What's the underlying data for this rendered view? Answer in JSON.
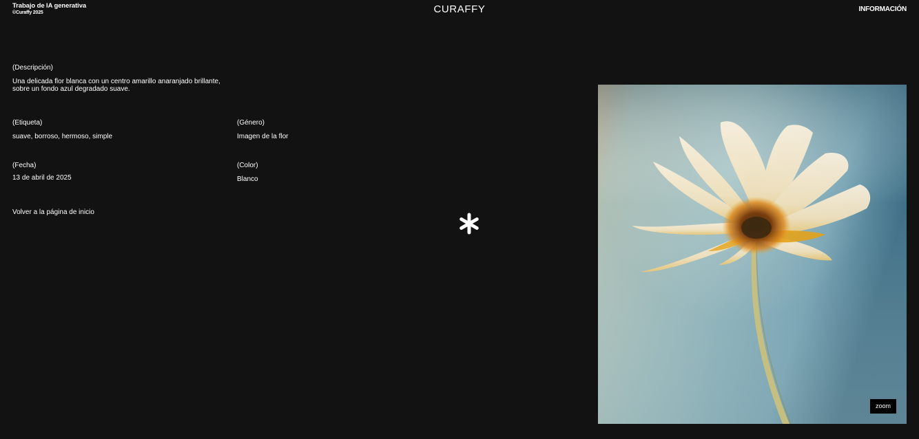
{
  "header": {
    "tagline": "Trabajo de IA generativa",
    "copyright": "©Curaffy 2025",
    "logo": "CURAFFY",
    "nav_info": "INFORMACIÓN"
  },
  "details": {
    "description_label": "(Descripción)",
    "description_text": "Una delicada flor blanca con un centro amarillo anaranjado brillante, sobre un fondo azul degradado suave.",
    "tag_label": "(Etiqueta)",
    "tag_value": "suave, borroso, hermoso, simple",
    "genre_label": "(Género)",
    "genre_value": "Imagen de la flor",
    "date_label": "(Fecha)",
    "date_value": "13 de abril de 2025",
    "color_label": "(Color)",
    "color_value": "Blanco",
    "back_link": "Volver a la página de inicio"
  },
  "artwork": {
    "zoom_label": "zoom"
  },
  "icons": {
    "divider": "asterisk-icon"
  },
  "colors": {
    "background": "#121212",
    "text": "#ffffff",
    "zoom_bg": "#000000"
  }
}
